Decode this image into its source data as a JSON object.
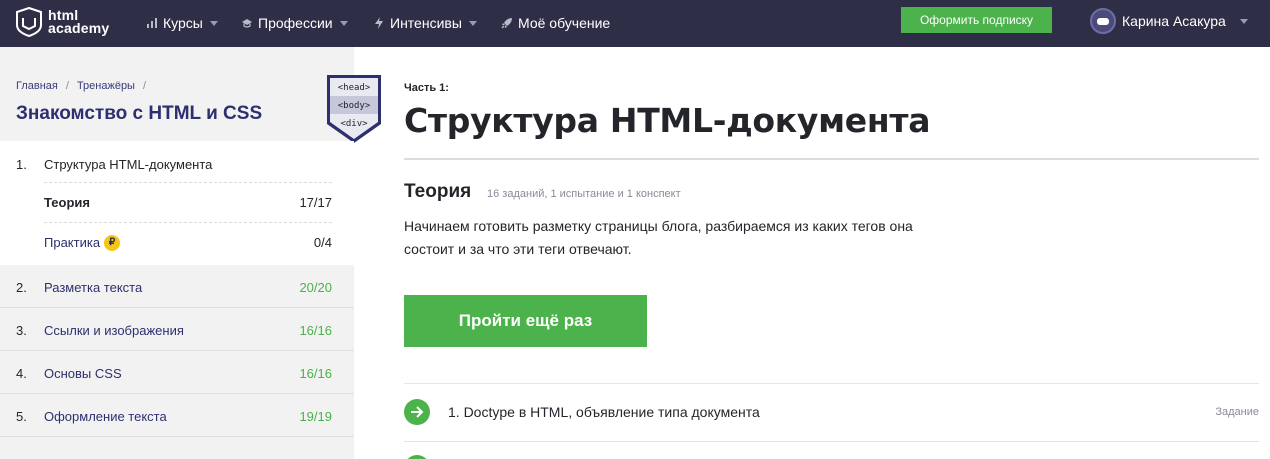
{
  "header": {
    "logo": {
      "line1": "html",
      "line2": "academy"
    },
    "nav": [
      {
        "label": "Курсы",
        "icon": "bars-chart-icon"
      },
      {
        "label": "Профессии",
        "icon": "graduation-cap-icon"
      },
      {
        "label": "Интенсивы",
        "icon": "lightning-icon"
      },
      {
        "label": "Моё обучение",
        "icon": "rocket-icon"
      }
    ],
    "subscribe_label": "Оформить подписку",
    "user_name": "Карина Асакура"
  },
  "sidebar": {
    "breadcrumbs": [
      "Главная",
      "Тренажёры"
    ],
    "course_title": "Знакомство с HTML и CSS",
    "badge": [
      "<head>",
      "<body>",
      "<div>"
    ],
    "chapters": [
      {
        "num": "1.",
        "label": "Структура HTML-документа",
        "sub": [
          {
            "label": "Теория",
            "score": "17/17"
          },
          {
            "label": "Практика",
            "coin": "₽",
            "score": "0/4"
          }
        ]
      },
      {
        "num": "2.",
        "label": "Разметка текста",
        "score": "20/20"
      },
      {
        "num": "3.",
        "label": "Ссылки и изображения",
        "score": "16/16"
      },
      {
        "num": "4.",
        "label": "Основы CSS",
        "score": "16/16"
      },
      {
        "num": "5.",
        "label": "Оформление текста",
        "score": "19/19"
      }
    ]
  },
  "main": {
    "part_label": "Часть 1:",
    "title": "Структура HTML-документа",
    "theory": {
      "title": "Теория",
      "meta": "16 заданий, 1 испытание и 1 конспект",
      "description": "Начинаем готовить разметку страницы блога, разбираемся из каких тегов она состоит и за что эти теги отвечают."
    },
    "retry_label": "Пройти ещё раз",
    "tasks": [
      {
        "label": "1. Doctype в HTML, объявление типа документа",
        "type": "Задание"
      }
    ]
  },
  "colors": {
    "nav_bg": "#2e2f47",
    "accent_green": "#4cb24b",
    "link_blue": "#2e2f6e",
    "sidebar_bg": "#f2f2f2"
  }
}
